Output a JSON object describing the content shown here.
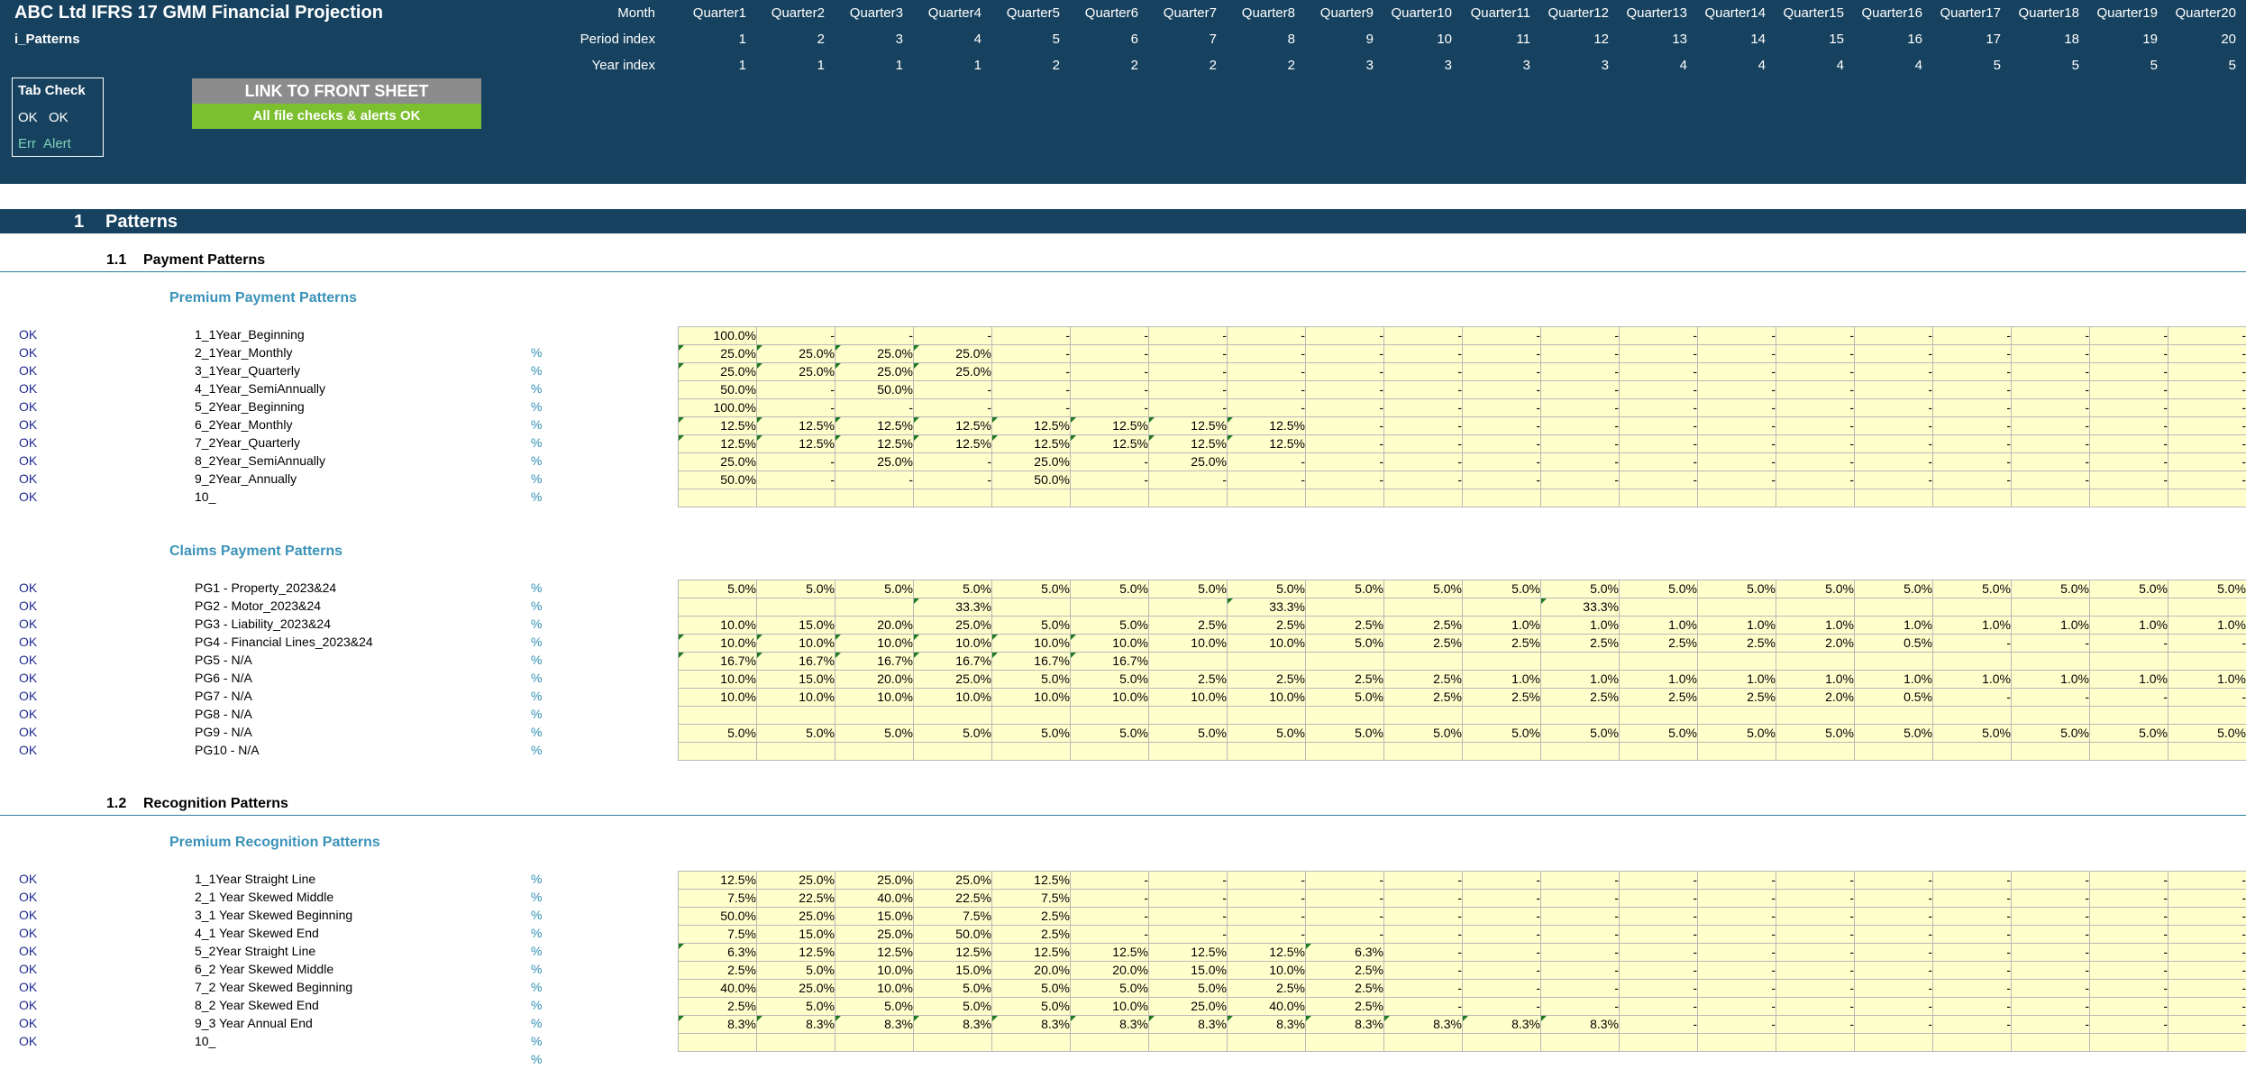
{
  "header": {
    "app_title": "ABC Ltd IFRS 17 GMM Financial Projection",
    "sheet_name": "i_Patterns",
    "row_labels": {
      "month": "Month",
      "period": "Period index",
      "year": "Year index"
    },
    "quarters": [
      "Quarter1",
      "Quarter2",
      "Quarter3",
      "Quarter4",
      "Quarter5",
      "Quarter6",
      "Quarter7",
      "Quarter8",
      "Quarter9",
      "Quarter10",
      "Quarter11",
      "Quarter12",
      "Quarter13",
      "Quarter14",
      "Quarter15",
      "Quarter16",
      "Quarter17",
      "Quarter18",
      "Quarter19",
      "Quarter20"
    ],
    "period_index": [
      "1",
      "2",
      "3",
      "4",
      "5",
      "6",
      "7",
      "8",
      "9",
      "10",
      "11",
      "12",
      "13",
      "14",
      "15",
      "16",
      "17",
      "18",
      "19",
      "20"
    ],
    "year_index": [
      "1",
      "1",
      "1",
      "1",
      "2",
      "2",
      "2",
      "2",
      "3",
      "3",
      "3",
      "3",
      "4",
      "4",
      "4",
      "4",
      "5",
      "5",
      "5",
      "5"
    ],
    "tab_check": {
      "title": "Tab Check",
      "ok1": "OK",
      "ok2": "OK",
      "err": "Err",
      "alert": "Alert"
    },
    "link_button": "LINK TO FRONT SHEET",
    "checks_status": "All file checks & alerts OK"
  },
  "section": {
    "number": "1",
    "title": "Patterns"
  },
  "subsections": [
    {
      "number": "1.1",
      "title": "Payment Patterns"
    },
    {
      "number": "1.2",
      "title": "Recognition Patterns"
    }
  ],
  "groups": [
    {
      "title": "Premium Payment Patterns",
      "rows": [
        {
          "status": "OK",
          "label": "1_1Year_Beginning",
          "unit": "",
          "values": [
            "100.0%",
            "-",
            "-",
            "-",
            "-",
            "-",
            "-",
            "-",
            "-",
            "-",
            "-",
            "-",
            "-",
            "-",
            "-",
            "-",
            "-",
            "-",
            "-",
            "-"
          ]
        },
        {
          "status": "OK",
          "label": "2_1Year_Monthly",
          "unit": "%",
          "values": [
            "25.0%",
            "25.0%",
            "25.0%",
            "25.0%",
            "-",
            "-",
            "-",
            "-",
            "-",
            "-",
            "-",
            "-",
            "-",
            "-",
            "-",
            "-",
            "-",
            "-",
            "-",
            "-"
          ]
        },
        {
          "status": "OK",
          "label": "3_1Year_Quarterly",
          "unit": "%",
          "values": [
            "25.0%",
            "25.0%",
            "25.0%",
            "25.0%",
            "-",
            "-",
            "-",
            "-",
            "-",
            "-",
            "-",
            "-",
            "-",
            "-",
            "-",
            "-",
            "-",
            "-",
            "-",
            "-"
          ]
        },
        {
          "status": "OK",
          "label": "4_1Year_SemiAnnually",
          "unit": "%",
          "values": [
            "50.0%",
            "-",
            "50.0%",
            "-",
            "-",
            "-",
            "-",
            "-",
            "-",
            "-",
            "-",
            "-",
            "-",
            "-",
            "-",
            "-",
            "-",
            "-",
            "-",
            "-"
          ]
        },
        {
          "status": "OK",
          "label": "5_2Year_Beginning",
          "unit": "%",
          "values": [
            "100.0%",
            "-",
            "-",
            "-",
            "-",
            "-",
            "-",
            "-",
            "-",
            "-",
            "-",
            "-",
            "-",
            "-",
            "-",
            "-",
            "-",
            "-",
            "-",
            "-"
          ]
        },
        {
          "status": "OK",
          "label": "6_2Year_Monthly",
          "unit": "%",
          "values": [
            "12.5%",
            "12.5%",
            "12.5%",
            "12.5%",
            "12.5%",
            "12.5%",
            "12.5%",
            "12.5%",
            "-",
            "-",
            "-",
            "-",
            "-",
            "-",
            "-",
            "-",
            "-",
            "-",
            "-",
            "-"
          ]
        },
        {
          "status": "OK",
          "label": "7_2Year_Quarterly",
          "unit": "%",
          "values": [
            "12.5%",
            "12.5%",
            "12.5%",
            "12.5%",
            "12.5%",
            "12.5%",
            "12.5%",
            "12.5%",
            "-",
            "-",
            "-",
            "-",
            "-",
            "-",
            "-",
            "-",
            "-",
            "-",
            "-",
            "-"
          ]
        },
        {
          "status": "OK",
          "label": "8_2Year_SemiAnnually",
          "unit": "%",
          "values": [
            "25.0%",
            "-",
            "25.0%",
            "-",
            "25.0%",
            "-",
            "25.0%",
            "-",
            "-",
            "-",
            "-",
            "-",
            "-",
            "-",
            "-",
            "-",
            "-",
            "-",
            "-",
            "-"
          ]
        },
        {
          "status": "OK",
          "label": "9_2Year_Annually",
          "unit": "%",
          "values": [
            "50.0%",
            "-",
            "-",
            "-",
            "50.0%",
            "-",
            "-",
            "-",
            "-",
            "-",
            "-",
            "-",
            "-",
            "-",
            "-",
            "-",
            "-",
            "-",
            "-",
            "-"
          ]
        },
        {
          "status": "OK",
          "label": "10_",
          "unit": "%",
          "values": [
            "",
            "",
            "",
            "",
            "",
            "",
            "",
            "",
            "",
            "",
            "",
            "",
            "",
            "",
            "",
            "",
            "",
            "",
            "",
            ""
          ]
        }
      ]
    },
    {
      "title": "Claims Payment Patterns",
      "rows": [
        {
          "status": "OK",
          "label": "PG1 - Property_2023&24",
          "unit": "%",
          "values": [
            "5.0%",
            "5.0%",
            "5.0%",
            "5.0%",
            "5.0%",
            "5.0%",
            "5.0%",
            "5.0%",
            "5.0%",
            "5.0%",
            "5.0%",
            "5.0%",
            "5.0%",
            "5.0%",
            "5.0%",
            "5.0%",
            "5.0%",
            "5.0%",
            "5.0%",
            "5.0%"
          ]
        },
        {
          "status": "OK",
          "label": "PG2 - Motor_2023&24",
          "unit": "%",
          "values": [
            "",
            "",
            "",
            "33.3%",
            "",
            "",
            "",
            "33.3%",
            "",
            "",
            "",
            "33.3%",
            "",
            "",
            "",
            "",
            "",
            "",
            "",
            ""
          ]
        },
        {
          "status": "OK",
          "label": "PG3 - Liability_2023&24",
          "unit": "%",
          "values": [
            "10.0%",
            "15.0%",
            "20.0%",
            "25.0%",
            "5.0%",
            "5.0%",
            "2.5%",
            "2.5%",
            "2.5%",
            "2.5%",
            "1.0%",
            "1.0%",
            "1.0%",
            "1.0%",
            "1.0%",
            "1.0%",
            "1.0%",
            "1.0%",
            "1.0%",
            "1.0%"
          ]
        },
        {
          "status": "OK",
          "label": "PG4 - Financial Lines_2023&24",
          "unit": "%",
          "values": [
            "10.0%",
            "10.0%",
            "10.0%",
            "10.0%",
            "10.0%",
            "10.0%",
            "10.0%",
            "10.0%",
            "5.0%",
            "2.5%",
            "2.5%",
            "2.5%",
            "2.5%",
            "2.5%",
            "2.0%",
            "0.5%",
            "-",
            "-",
            "-",
            "-"
          ]
        },
        {
          "status": "OK",
          "label": "PG5 - N/A",
          "unit": "%",
          "values": [
            "16.7%",
            "16.7%",
            "16.7%",
            "16.7%",
            "16.7%",
            "16.7%",
            "",
            "",
            "",
            "",
            "",
            "",
            "",
            "",
            "",
            "",
            "",
            "",
            "",
            ""
          ]
        },
        {
          "status": "OK",
          "label": "PG6 - N/A",
          "unit": "%",
          "values": [
            "10.0%",
            "15.0%",
            "20.0%",
            "25.0%",
            "5.0%",
            "5.0%",
            "2.5%",
            "2.5%",
            "2.5%",
            "2.5%",
            "1.0%",
            "1.0%",
            "1.0%",
            "1.0%",
            "1.0%",
            "1.0%",
            "1.0%",
            "1.0%",
            "1.0%",
            "1.0%"
          ]
        },
        {
          "status": "OK",
          "label": "PG7 - N/A",
          "unit": "%",
          "values": [
            "10.0%",
            "10.0%",
            "10.0%",
            "10.0%",
            "10.0%",
            "10.0%",
            "10.0%",
            "10.0%",
            "5.0%",
            "2.5%",
            "2.5%",
            "2.5%",
            "2.5%",
            "2.5%",
            "2.0%",
            "0.5%",
            "-",
            "-",
            "-",
            "-"
          ]
        },
        {
          "status": "OK",
          "label": "PG8 - N/A",
          "unit": "%",
          "values": [
            "",
            "",
            "",
            "",
            "",
            "",
            "",
            "",
            "",
            "",
            "",
            "",
            "",
            "",
            "",
            "",
            "",
            "",
            "",
            ""
          ]
        },
        {
          "status": "OK",
          "label": "PG9 - N/A",
          "unit": "%",
          "values": [
            "5.0%",
            "5.0%",
            "5.0%",
            "5.0%",
            "5.0%",
            "5.0%",
            "5.0%",
            "5.0%",
            "5.0%",
            "5.0%",
            "5.0%",
            "5.0%",
            "5.0%",
            "5.0%",
            "5.0%",
            "5.0%",
            "5.0%",
            "5.0%",
            "5.0%",
            "5.0%"
          ]
        },
        {
          "status": "OK",
          "label": "PG10 - N/A",
          "unit": "%",
          "values": [
            "",
            "",
            "",
            "",
            "",
            "",
            "",
            "",
            "",
            "",
            "",
            "",
            "",
            "",
            "",
            "",
            "",
            "",
            "",
            ""
          ]
        }
      ]
    },
    {
      "title": "Premium Recognition Patterns",
      "rows": [
        {
          "status": "OK",
          "label": "1_1Year Straight Line",
          "unit": "%",
          "values": [
            "12.5%",
            "25.0%",
            "25.0%",
            "25.0%",
            "12.5%",
            "-",
            "-",
            "-",
            "-",
            "-",
            "-",
            "-",
            "-",
            "-",
            "-",
            "-",
            "-",
            "-",
            "-",
            "-"
          ]
        },
        {
          "status": "OK",
          "label": "2_1 Year Skewed Middle",
          "unit": "%",
          "values": [
            "7.5%",
            "22.5%",
            "40.0%",
            "22.5%",
            "7.5%",
            "-",
            "-",
            "-",
            "-",
            "-",
            "-",
            "-",
            "-",
            "-",
            "-",
            "-",
            "-",
            "-",
            "-",
            "-"
          ]
        },
        {
          "status": "OK",
          "label": "3_1 Year Skewed Beginning",
          "unit": "%",
          "values": [
            "50.0%",
            "25.0%",
            "15.0%",
            "7.5%",
            "2.5%",
            "-",
            "-",
            "-",
            "-",
            "-",
            "-",
            "-",
            "-",
            "-",
            "-",
            "-",
            "-",
            "-",
            "-",
            "-"
          ]
        },
        {
          "status": "OK",
          "label": "4_1 Year Skewed End",
          "unit": "%",
          "values": [
            "7.5%",
            "15.0%",
            "25.0%",
            "50.0%",
            "2.5%",
            "-",
            "-",
            "-",
            "-",
            "-",
            "-",
            "-",
            "-",
            "-",
            "-",
            "-",
            "-",
            "-",
            "-",
            "-"
          ]
        },
        {
          "status": "OK",
          "label": "5_2Year Straight Line",
          "unit": "%",
          "values": [
            "6.3%",
            "12.5%",
            "12.5%",
            "12.5%",
            "12.5%",
            "12.5%",
            "12.5%",
            "12.5%",
            "6.3%",
            "-",
            "-",
            "-",
            "-",
            "-",
            "-",
            "-",
            "-",
            "-",
            "-",
            "-"
          ]
        },
        {
          "status": "OK",
          "label": "6_2 Year Skewed Middle",
          "unit": "%",
          "values": [
            "2.5%",
            "5.0%",
            "10.0%",
            "15.0%",
            "20.0%",
            "20.0%",
            "15.0%",
            "10.0%",
            "2.5%",
            "-",
            "-",
            "-",
            "-",
            "-",
            "-",
            "-",
            "-",
            "-",
            "-",
            "-"
          ]
        },
        {
          "status": "OK",
          "label": "7_2 Year Skewed Beginning",
          "unit": "%",
          "values": [
            "40.0%",
            "25.0%",
            "10.0%",
            "5.0%",
            "5.0%",
            "5.0%",
            "5.0%",
            "2.5%",
            "2.5%",
            "-",
            "-",
            "-",
            "-",
            "-",
            "-",
            "-",
            "-",
            "-",
            "-",
            "-"
          ]
        },
        {
          "status": "OK",
          "label": "8_2 Year Skewed End",
          "unit": "%",
          "values": [
            "2.5%",
            "5.0%",
            "5.0%",
            "5.0%",
            "5.0%",
            "10.0%",
            "25.0%",
            "40.0%",
            "2.5%",
            "-",
            "-",
            "-",
            "-",
            "-",
            "-",
            "-",
            "-",
            "-",
            "-",
            "-"
          ]
        },
        {
          "status": "OK",
          "label": "9_3 Year Annual End",
          "unit": "%",
          "values": [
            "8.3%",
            "8.3%",
            "8.3%",
            "8.3%",
            "8.3%",
            "8.3%",
            "8.3%",
            "8.3%",
            "8.3%",
            "8.3%",
            "8.3%",
            "8.3%",
            "-",
            "-",
            "-",
            "-",
            "-",
            "-",
            "-",
            "-"
          ]
        },
        {
          "status": "OK",
          "label": "10_",
          "unit": "%",
          "values": [
            "",
            "",
            "",
            "",
            "",
            "",
            "",
            "",
            "",
            "",
            "",
            "",
            "",
            "",
            "",
            "",
            "",
            "",
            "",
            ""
          ]
        },
        {
          "status": "",
          "label": "",
          "unit": "%",
          "values": null
        }
      ]
    }
  ]
}
